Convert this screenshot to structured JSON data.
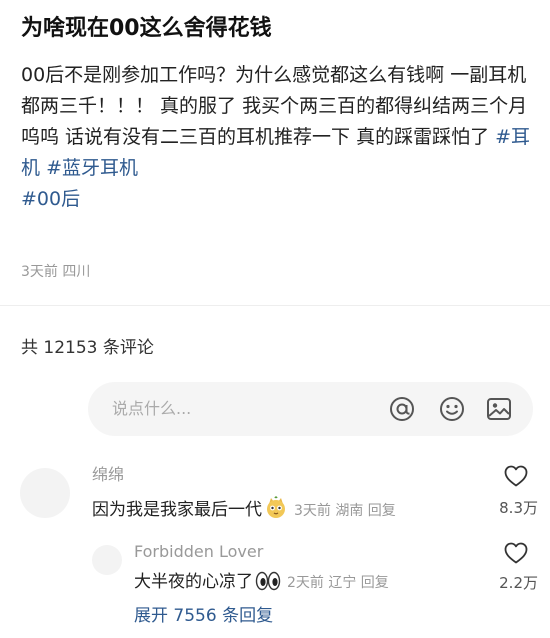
{
  "post": {
    "title": "为啥现在00这么舍得花钱",
    "body": "00后不是刚参加工作吗？为什么感觉都这么有钱啊 一副耳机都两三千！！！ 真的服了 我买个两三百的都得纠结两三个月呜呜 话说有没有二三百的耳机推荐一下 真的踩雷踩怕了 ",
    "tags": [
      "#耳机",
      "#蓝牙耳机",
      "#00后"
    ],
    "meta": "3天前 四川"
  },
  "comments_header": {
    "count_text": "共 12153 条评论"
  },
  "input": {
    "placeholder": "说点什么...",
    "icons": [
      "at-icon",
      "emoji-icon",
      "image-icon"
    ]
  },
  "comments": [
    {
      "name": "绵绵",
      "text": "因为我是我家最后一代",
      "emoji": "cat-face-emoji",
      "meta": "3天前 湖南 回复",
      "likes": "8.3万"
    },
    {
      "name": "Forbidden Lover",
      "text": "大半夜的心凉了",
      "emoji": "eyes-emoji",
      "meta": "2天前 辽宁 回复",
      "likes": "2.2万"
    }
  ],
  "expand_text": "展开 7556 条回复",
  "colors": {
    "link": "#2f5a8f",
    "muted": "#999999",
    "input_bg": "#f5f5f5"
  }
}
